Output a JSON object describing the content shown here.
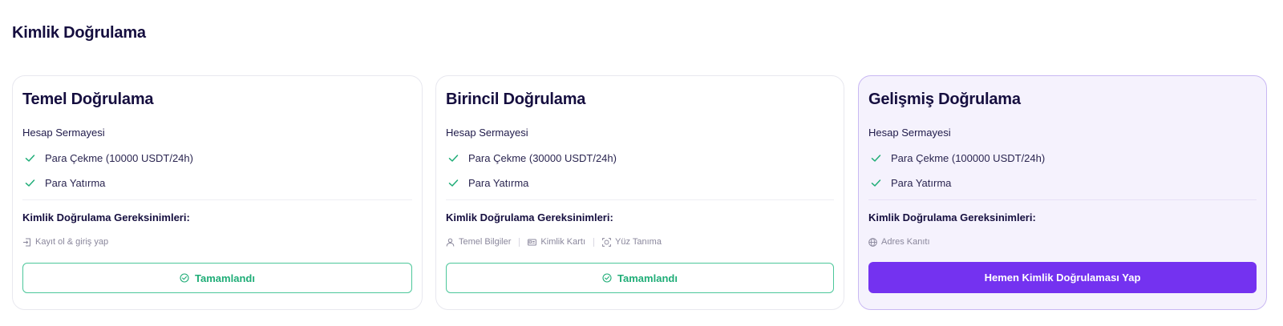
{
  "page": {
    "title": "Kimlik Doğrulama"
  },
  "colors": {
    "accent": "#7432f0",
    "success": "#1fad77",
    "title": "#150e3f",
    "highlight_card_bg": "#f5f2fd"
  },
  "cards": [
    {
      "title": "Temel Doğrulama",
      "section_label": "Hesap Sermayesi",
      "features": [
        {
          "icon": "check-icon",
          "label": "Para Çekme (10000 USDT/24h)"
        },
        {
          "icon": "check-icon",
          "label": "Para Yatırma"
        }
      ],
      "requirements_title": "Kimlik Doğrulama Gereksinimleri:",
      "requirements": [
        {
          "icon": "login-icon",
          "label": "Kayıt ol & giriş yap"
        }
      ],
      "button": {
        "type": "completed",
        "icon": "check-circle-icon",
        "label": "Tamamlandı"
      }
    },
    {
      "title": "Birincil Doğrulama",
      "section_label": "Hesap Sermayesi",
      "features": [
        {
          "icon": "check-icon",
          "label": "Para Çekme (30000 USDT/24h)"
        },
        {
          "icon": "check-icon",
          "label": "Para Yatırma"
        }
      ],
      "requirements_title": "Kimlik Doğrulama Gereksinimleri:",
      "requirements": [
        {
          "icon": "user-icon",
          "label": "Temel Bilgiler"
        },
        {
          "icon": "id-card-icon",
          "label": "Kimlik Kartı"
        },
        {
          "icon": "face-scan-icon",
          "label": "Yüz Tanıma"
        }
      ],
      "button": {
        "type": "completed",
        "icon": "check-circle-icon",
        "label": "Tamamlandı"
      }
    },
    {
      "title": "Gelişmiş Doğrulama",
      "section_label": "Hesap Sermayesi",
      "features": [
        {
          "icon": "check-icon",
          "label": "Para Çekme (100000 USDT/24h)"
        },
        {
          "icon": "check-icon",
          "label": "Para Yatırma"
        }
      ],
      "requirements_title": "Kimlik Doğrulama Gereksinimleri:",
      "requirements": [
        {
          "icon": "globe-icon",
          "label": "Adres Kanıtı"
        }
      ],
      "button": {
        "type": "primary",
        "label": "Hemen Kimlik Doğrulaması Yap"
      }
    }
  ]
}
